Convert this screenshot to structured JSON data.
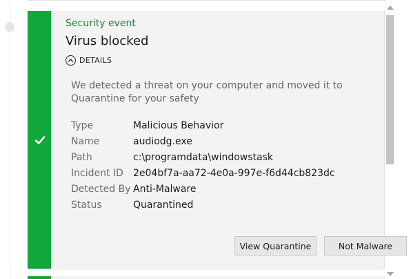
{
  "colors": {
    "accent": "#10a73b",
    "category_text": "#10893e",
    "card_background": "#f3f3f3"
  },
  "event": {
    "category": "Security event",
    "title": "Virus blocked",
    "status_icon": "checkmark-icon",
    "details_toggle": {
      "label": "DETAILS",
      "icon": "chevron-up-circle-icon",
      "expanded": true
    },
    "description": "We detected a threat on your computer and moved it to Quarantine for your safety",
    "fields": [
      {
        "label": "Type",
        "value": "Malicious Behavior"
      },
      {
        "label": "Name",
        "value": "audiodg.exe"
      },
      {
        "label": "Path",
        "value": "c:\\programdata\\windowstask"
      },
      {
        "label": "Incident ID",
        "value": "2e04bf7a-aa72-4e0a-997e-f6d44cb823dc"
      },
      {
        "label": "Detected By",
        "value": "Anti-Malware"
      },
      {
        "label": "Status",
        "value": "Quarantined"
      }
    ],
    "actions": {
      "view_quarantine": "View Quarantine",
      "not_malware": "Not Malware"
    }
  }
}
